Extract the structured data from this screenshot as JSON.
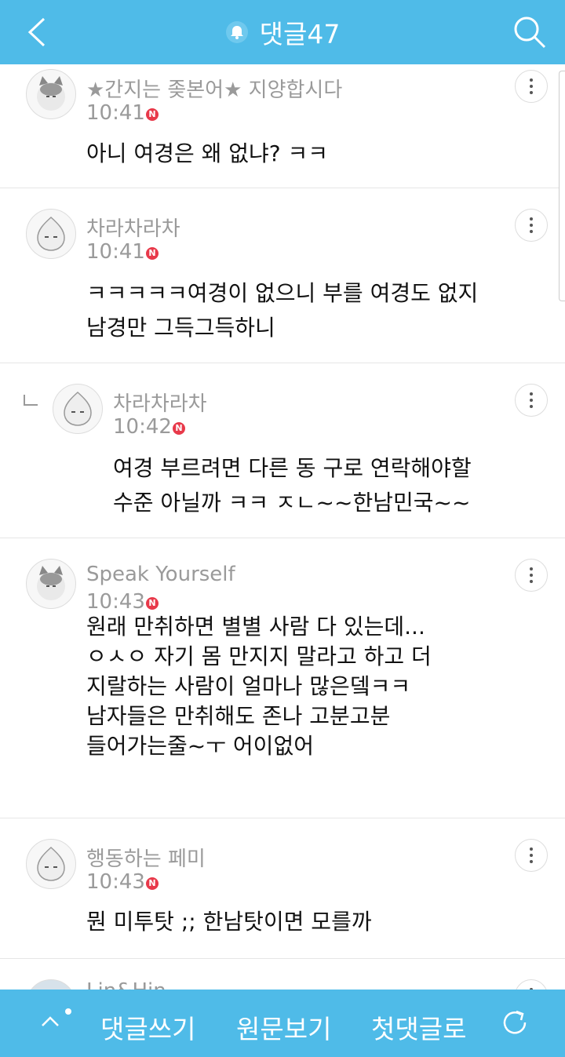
{
  "header": {
    "title": "댓글47",
    "back_icon": "chevron-left-icon",
    "bell_icon": "bell-icon",
    "search_icon": "search-icon"
  },
  "comments": [
    {
      "name": "★간지는 좆본어★ 지양합시다",
      "time": "10:41",
      "badge": "N",
      "lines": [
        "아니 여경은 왜 없냐?  ㅋㅋ"
      ]
    },
    {
      "name": "차라차라차",
      "time": "10:41",
      "badge": "N",
      "lines": [
        "ㅋㅋㅋㅋㅋ여경이 없으니 부를 여경도 없지",
        "남경만 그득그득하니"
      ]
    },
    {
      "name": "차라차라차",
      "time": "10:42",
      "badge": "N",
      "lines": [
        "여경 부르려면 다른 동 구로 연락해야할",
        "수준 아닐까 ㅋㅋ ㅈㄴ~~한남민국~~"
      ]
    },
    {
      "name": "Speak Yourself",
      "time": "10:43",
      "badge": "N",
      "lines": [
        "원래 만취하면 별별 사람 다 있는데...",
        "ㅇㅅㅇ 자기 몸 만지지 말라고 하고 더",
        "지랄하는 사람이 얼마나 많은뎈ㅋㅋ",
        "남자들은 만취해도 존나 고분고분",
        "들어가는줄~ㅜ 어이없어"
      ]
    },
    {
      "name": "행동하는 페미",
      "time": "10:43",
      "badge": "N",
      "lines": [
        "뭔 미투탓 ;; 한남탓이면 모를까"
      ]
    },
    {
      "name": "Lin&Hin",
      "time": "",
      "badge": "",
      "lines": []
    }
  ],
  "bottom": {
    "write": "댓글쓰기",
    "original": "원문보기",
    "first": "첫댓글로"
  },
  "colors": {
    "bar": "#4fbbe8",
    "badge": "#e8394a"
  }
}
